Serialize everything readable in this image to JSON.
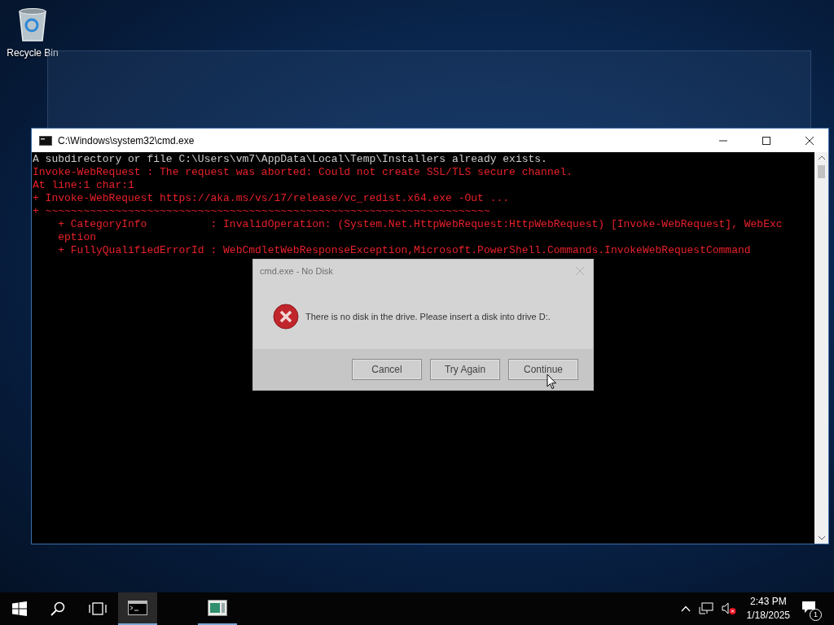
{
  "desktop": {
    "icons": [
      {
        "label": "Recycle Bin"
      }
    ]
  },
  "console_window": {
    "title": "C:\\Windows\\system32\\cmd.exe",
    "lines": [
      {
        "text": "A subdirectory or file C:\\Users\\vm7\\AppData\\Local\\Temp\\Installers already exists.",
        "kind": "output"
      },
      {
        "text": "Invoke-WebRequest : The request was aborted: Could not create SSL/TLS secure channel.",
        "kind": "error"
      },
      {
        "text": "At line:1 char:1",
        "kind": "error"
      },
      {
        "text": "+ Invoke-WebRequest https://aka.ms/vs/17/release/vc_redist.x64.exe -Out ...",
        "kind": "error"
      },
      {
        "text": "+ ~~~~~~~~~~~~~~~~~~~~~~~~~~~~~~~~~~~~~~~~~~~~~~~~~~~~~~~~~~~~~~~~~~~~~~",
        "kind": "error"
      },
      {
        "text": "    + CategoryInfo          : InvalidOperation: (System.Net.HttpWebRequest:HttpWebRequest) [Invoke-WebRequest], WebExc",
        "kind": "error"
      },
      {
        "text": "    eption",
        "kind": "error"
      },
      {
        "text": "    + FullyQualifiedErrorId : WebCmdletWebResponseException,Microsoft.PowerShell.Commands.InvokeWebRequestCommand",
        "kind": "error"
      }
    ]
  },
  "dialog": {
    "title": "cmd.exe - No Disk",
    "message": "There is no disk in the drive. Please insert a disk into drive D:.",
    "buttons": [
      "Cancel",
      "Try Again",
      "Continue"
    ]
  },
  "taskbar": {
    "apps": [
      {
        "kind": "console",
        "selected": true
      },
      {
        "kind": "window",
        "selected": false
      }
    ],
    "clock": {
      "time": "2:43 PM",
      "date": "1/18/2025"
    },
    "notifications": {
      "count": "1"
    }
  }
}
